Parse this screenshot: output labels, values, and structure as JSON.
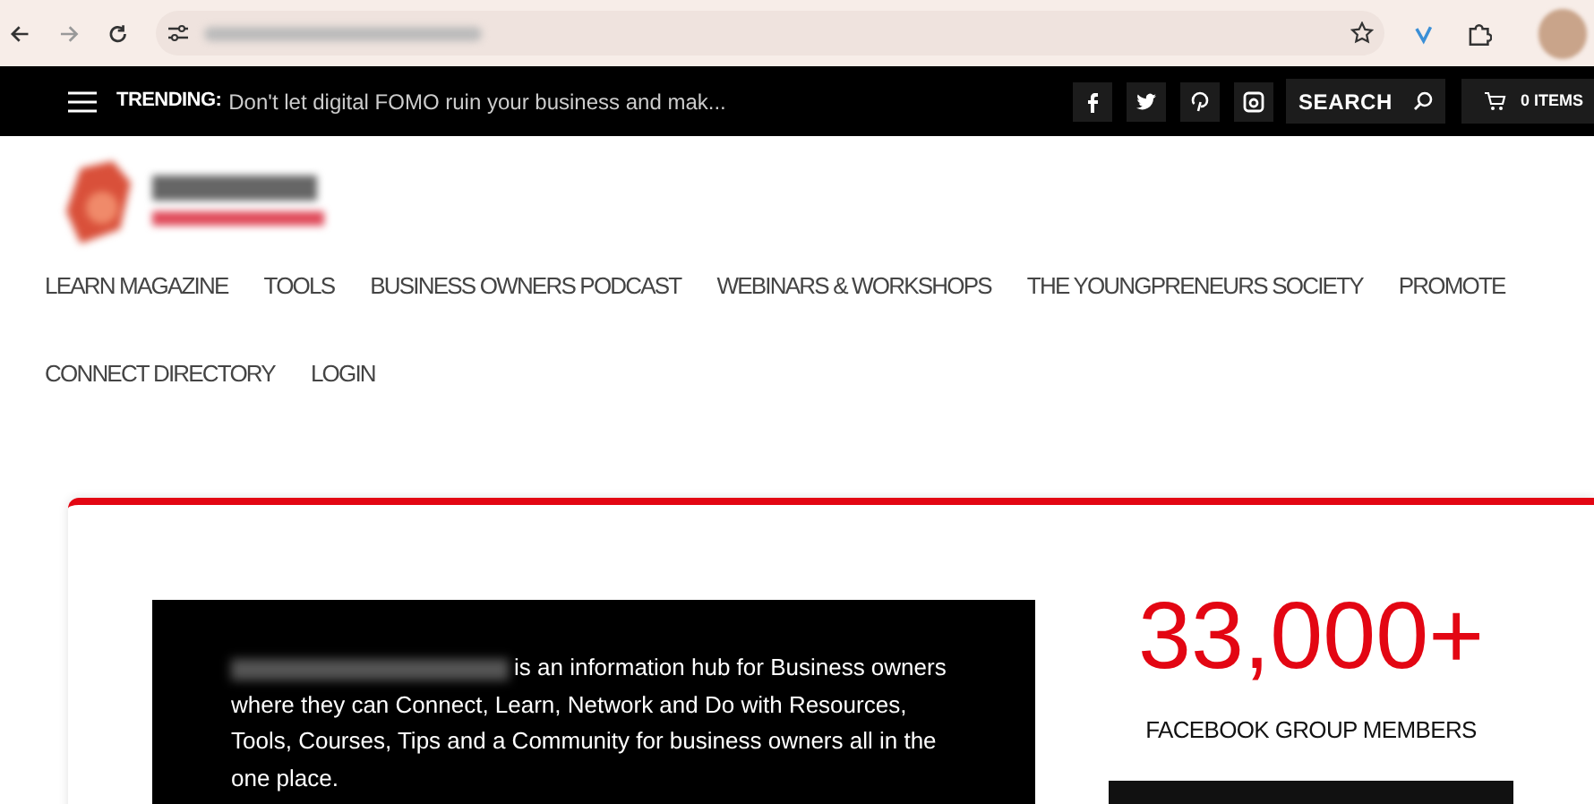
{
  "trending": {
    "label": "TRENDING:",
    "headline": "Don't let digital FOMO ruin your business and mak..."
  },
  "search": {
    "label": "SEARCH"
  },
  "cart": {
    "label": "0 ITEMS"
  },
  "nav": [
    {
      "label": "LEARN MAGAZINE"
    },
    {
      "label": "TOOLS"
    },
    {
      "label": "BUSINESS OWNERS PODCAST"
    },
    {
      "label": "WEBINARS & WORKSHOPS"
    },
    {
      "label": "THE YOUNGPRENEURS SOCIETY"
    },
    {
      "label": "PROMOTE"
    },
    {
      "label": "CONNECT DIRECTORY"
    },
    {
      "label": "LOGIN"
    }
  ],
  "intro": {
    "text": "is an information hub for Business owners where they can Connect, Learn, Network and Do with Resources, Tools, Courses, Tips and a Community for business owners all in the one place."
  },
  "stat": {
    "value": "33,000+",
    "label": "FACEBOOK GROUP MEMBERS"
  }
}
